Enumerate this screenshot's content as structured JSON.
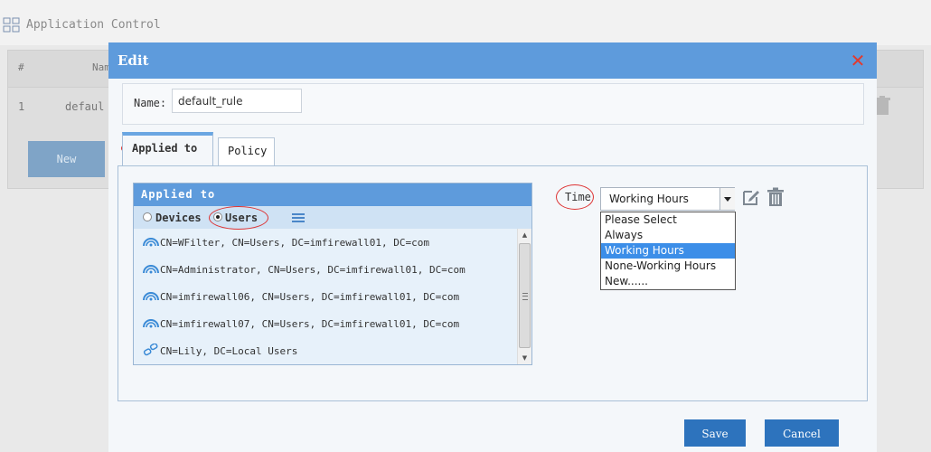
{
  "background": {
    "title": "Application Control",
    "table_header": {
      "hash": "#",
      "name": "Nam"
    },
    "row": {
      "num": "1",
      "name": "defaul"
    },
    "new_button": "New"
  },
  "modal": {
    "title": "Edit",
    "close_label": "✕",
    "name_label": "Name:",
    "name_value": "default_rule",
    "tabs": [
      {
        "label": "Applied to",
        "active": true
      },
      {
        "label": "Policy",
        "active": false
      }
    ],
    "applied_to": {
      "header": "Applied to",
      "radio_devices": "Devices",
      "radio_users": "Users",
      "selected": "Users",
      "items": [
        {
          "text": "CN=WFilter, CN=Users, DC=imfirewall01, DC=com",
          "icon": "domain-user-icon"
        },
        {
          "text": "CN=Administrator, CN=Users, DC=imfirewall01, DC=com",
          "icon": "domain-user-icon"
        },
        {
          "text": "CN=imfirewall06, CN=Users, DC=imfirewall01, DC=com",
          "icon": "domain-user-icon"
        },
        {
          "text": "CN=imfirewall07, CN=Users, DC=imfirewall01, DC=com",
          "icon": "domain-user-icon"
        },
        {
          "text": "CN=Lily, DC=Local Users",
          "icon": "local-user-icon"
        }
      ]
    },
    "time": {
      "label": "Time",
      "value": "Working Hours",
      "options": [
        "Please Select",
        "Always",
        "Working Hours",
        "None-Working Hours",
        "New......"
      ],
      "selected_index": 2
    },
    "save_label": "Save",
    "cancel_label": "Cancel"
  },
  "colors": {
    "header_blue": "#5e9bdc",
    "button_blue": "#2d73bd",
    "close_red": "#e23a2e",
    "annotation_red": "#dd3333",
    "dropdown_highlight": "#3c8ee8"
  }
}
